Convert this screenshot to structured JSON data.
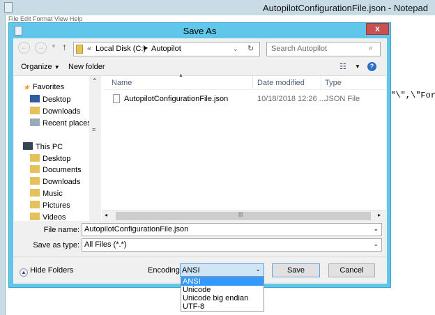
{
  "notepad": {
    "title": "AutopilotConfigurationFile.json - Notepad",
    "menu": "File  Edit  Format  View  Help",
    "content": ",\"\\\",\\\"Forc"
  },
  "dialog": {
    "title": "Save As",
    "close": "x",
    "address": {
      "prefix": "«",
      "path": [
        "Local Disk (C:)",
        "Autopilot"
      ]
    },
    "search": {
      "placeholder": "Search Autopilot"
    },
    "toolbar": {
      "organize": "Organize",
      "new_folder": "New folder"
    },
    "nav": {
      "favorites": {
        "label": "Favorites",
        "items": [
          "Desktop",
          "Downloads",
          "Recent places"
        ]
      },
      "this_pc": {
        "label": "This PC",
        "items": [
          "Desktop",
          "Documents",
          "Downloads",
          "Music",
          "Pictures",
          "Videos"
        ]
      }
    },
    "columns": [
      "Name",
      "Date modified",
      "Type"
    ],
    "files": [
      {
        "name": "AutopilotConfigurationFile.json",
        "date": "10/18/2018 12:26 ...",
        "type": "JSON File"
      }
    ],
    "file_name": {
      "label": "File name:",
      "value": "AutopilotConfigurationFile.json"
    },
    "save_as_type": {
      "label": "Save as type:",
      "value": "All Files  (*.*)"
    },
    "hide_folders": "Hide Folders",
    "encoding": {
      "label": "Encoding:",
      "value": "ANSI",
      "options": [
        "ANSI",
        "Unicode",
        "Unicode big endian",
        "UTF-8"
      ],
      "selected": "ANSI"
    },
    "save": "Save",
    "cancel": "Cancel"
  },
  "colors": {
    "dialog_border": "#61c7ea",
    "close": "#c75050",
    "selection": "#3399ff"
  }
}
